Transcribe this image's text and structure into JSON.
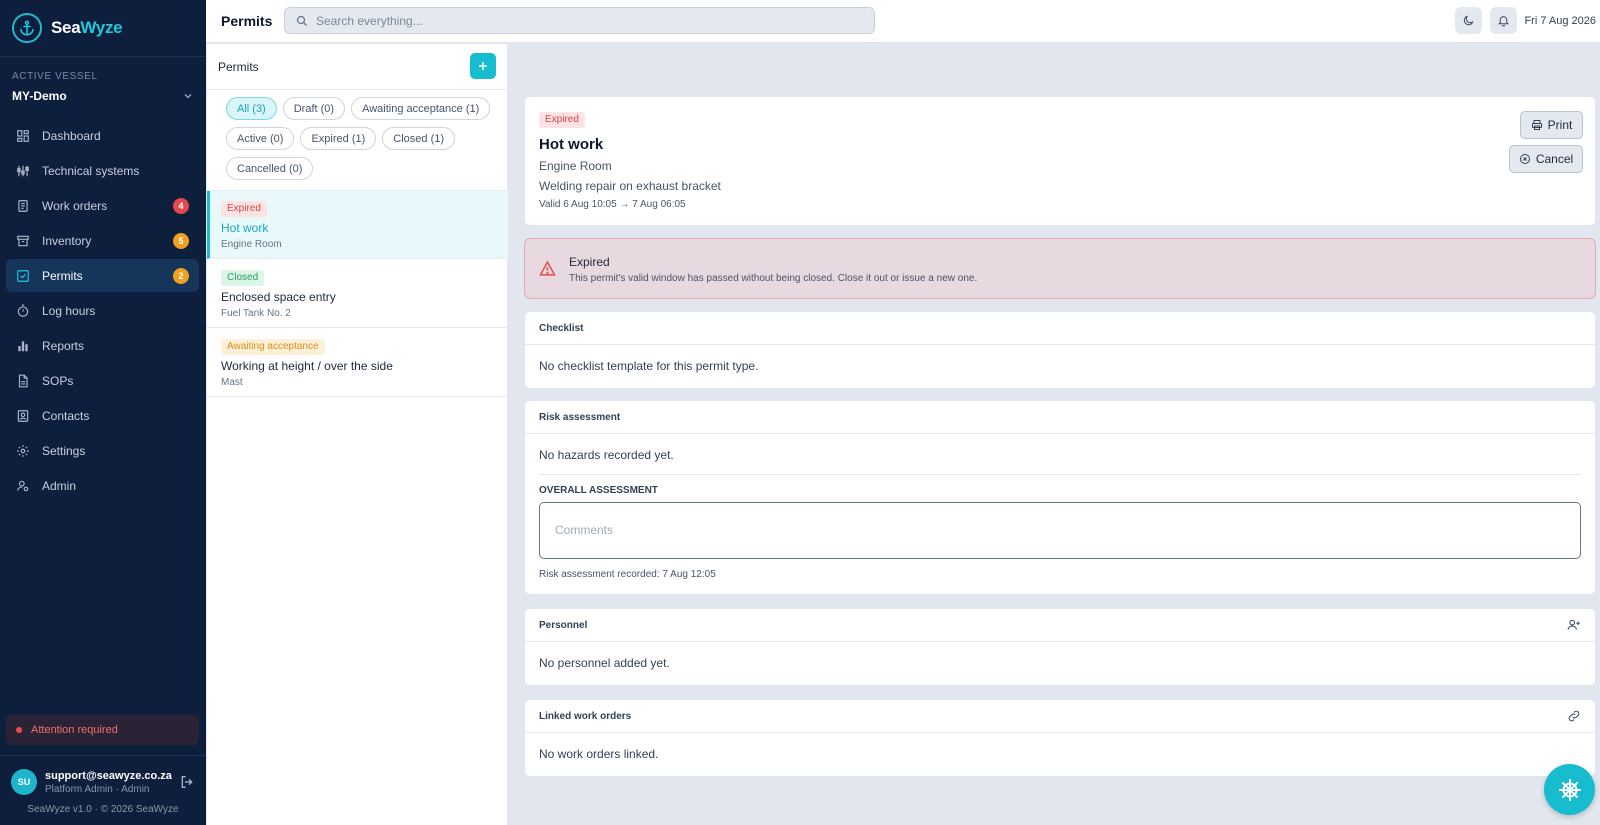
{
  "brand": {
    "name_prefix": "Sea",
    "name_suffix": "Wyze"
  },
  "vessel": {
    "label": "ACTIVE VESSEL",
    "name": "MY-Demo"
  },
  "nav": {
    "items": [
      {
        "label": "Dashboard",
        "icon": "dashboard-icon"
      },
      {
        "label": "Technical systems",
        "icon": "systems-icon"
      },
      {
        "label": "Work orders",
        "icon": "clipboard-icon",
        "badge": "4",
        "badge_color": "#e5484d"
      },
      {
        "label": "Inventory",
        "icon": "archive-icon",
        "badge": "5",
        "badge_color": "#f0a020"
      },
      {
        "label": "Permits",
        "icon": "checkbox-icon",
        "badge": "2",
        "badge_color": "#f0a020",
        "active": true
      },
      {
        "label": "Log hours",
        "icon": "stopwatch-icon"
      },
      {
        "label": "Reports",
        "icon": "bar-chart-icon"
      },
      {
        "label": "SOPs",
        "icon": "document-icon"
      },
      {
        "label": "Contacts",
        "icon": "contact-book-icon"
      },
      {
        "label": "Settings",
        "icon": "gear-icon"
      },
      {
        "label": "Admin",
        "icon": "admin-icon"
      }
    ]
  },
  "attention": {
    "label": "Attention required"
  },
  "user": {
    "initials": "SU",
    "email": "support@seawyze.co.za",
    "role": "Platform Admin · Admin"
  },
  "footer": {
    "version": "SeaWyze v1.0 · © 2026 SeaWyze"
  },
  "topbar": {
    "title": "Permits",
    "search_placeholder": "Search everything...",
    "date": "Fri 7 Aug 2026"
  },
  "permits_list": {
    "title": "Permits",
    "filters": [
      {
        "label": "All (3)",
        "active": true
      },
      {
        "label": "Draft (0)"
      },
      {
        "label": "Awaiting acceptance (1)"
      },
      {
        "label": "Active (0)"
      },
      {
        "label": "Expired (1)"
      },
      {
        "label": "Closed (1)"
      },
      {
        "label": "Cancelled (0)"
      }
    ],
    "items": [
      {
        "status": "Expired",
        "status_kind": "expired",
        "title": "Hot work",
        "location": "Engine Room",
        "selected": true
      },
      {
        "status": "Closed",
        "status_kind": "closed",
        "title": "Enclosed space entry",
        "location": "Fuel Tank No. 2"
      },
      {
        "status": "Awaiting acceptance",
        "status_kind": "awaiting",
        "title": "Working at height / over the side",
        "location": "Mast"
      }
    ]
  },
  "detail": {
    "status": "Expired",
    "title": "Hot work",
    "location": "Engine Room",
    "description": "Welding repair on exhaust bracket",
    "valid": "Valid 6 Aug 10:05 → 7 Aug 06:05",
    "print_label": "Print",
    "cancel_label": "Cancel"
  },
  "alert": {
    "title": "Expired",
    "text": "This permit's valid window has passed without being closed. Close it out or issue a new one."
  },
  "checklist": {
    "title": "Checklist",
    "empty": "No checklist template for this permit type."
  },
  "risk": {
    "title": "Risk assessment",
    "empty": "No hazards recorded yet.",
    "overall_label": "OVERALL ASSESSMENT",
    "comments_placeholder": "Comments",
    "recorded": "Risk assessment recorded: 7 Aug 12:05"
  },
  "personnel": {
    "title": "Personnel",
    "empty": "No personnel added yet."
  },
  "linked": {
    "title": "Linked work orders",
    "empty": "No work orders linked."
  },
  "colors": {
    "accent": "#17bccf",
    "sidebar": "#0d1f3c",
    "danger": "#e5484d",
    "warning": "#f0a020"
  }
}
